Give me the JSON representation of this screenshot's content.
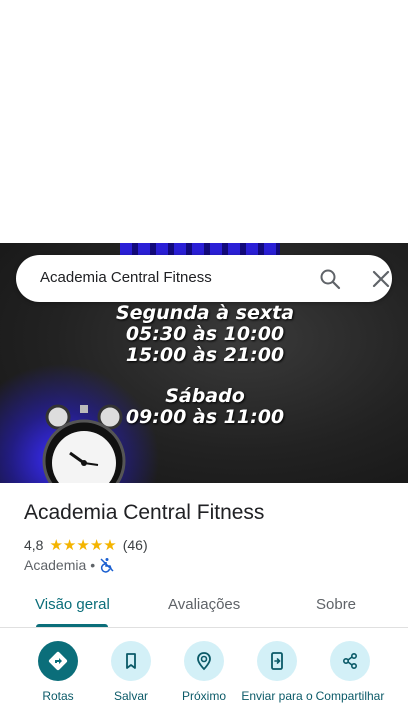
{
  "search": {
    "value": "Academia Central Fitness"
  },
  "hero": {
    "line1": "Segunda à sexta",
    "line2": "05:30 às 10:00",
    "line3": "15:00 às 21:00",
    "line4": "Sábado",
    "line5": "09:00 às 11:00"
  },
  "place": {
    "title": "Academia Central Fitness",
    "rating": "4,8",
    "stars": 5,
    "reviews": "(46)",
    "category": "Academia",
    "separator": "•",
    "wheelchair_icon": "not-accessible-icon"
  },
  "tabs": [
    {
      "label": "Visão geral",
      "active": true
    },
    {
      "label": "Avaliações",
      "active": false
    },
    {
      "label": "Sobre",
      "active": false
    }
  ],
  "actions": [
    {
      "label": "Rotas",
      "icon": "directions-icon"
    },
    {
      "label": "Salvar",
      "icon": "bookmark-icon"
    },
    {
      "label": "Próximo",
      "icon": "nearby-icon"
    },
    {
      "label": "Enviar para o",
      "icon": "send-to-phone-icon"
    },
    {
      "label": "Compartilhar",
      "icon": "share-icon"
    }
  ],
  "colors": {
    "accent": "#0b6e7a",
    "action_bg": "#d3f0f7",
    "star": "#f4b400"
  }
}
